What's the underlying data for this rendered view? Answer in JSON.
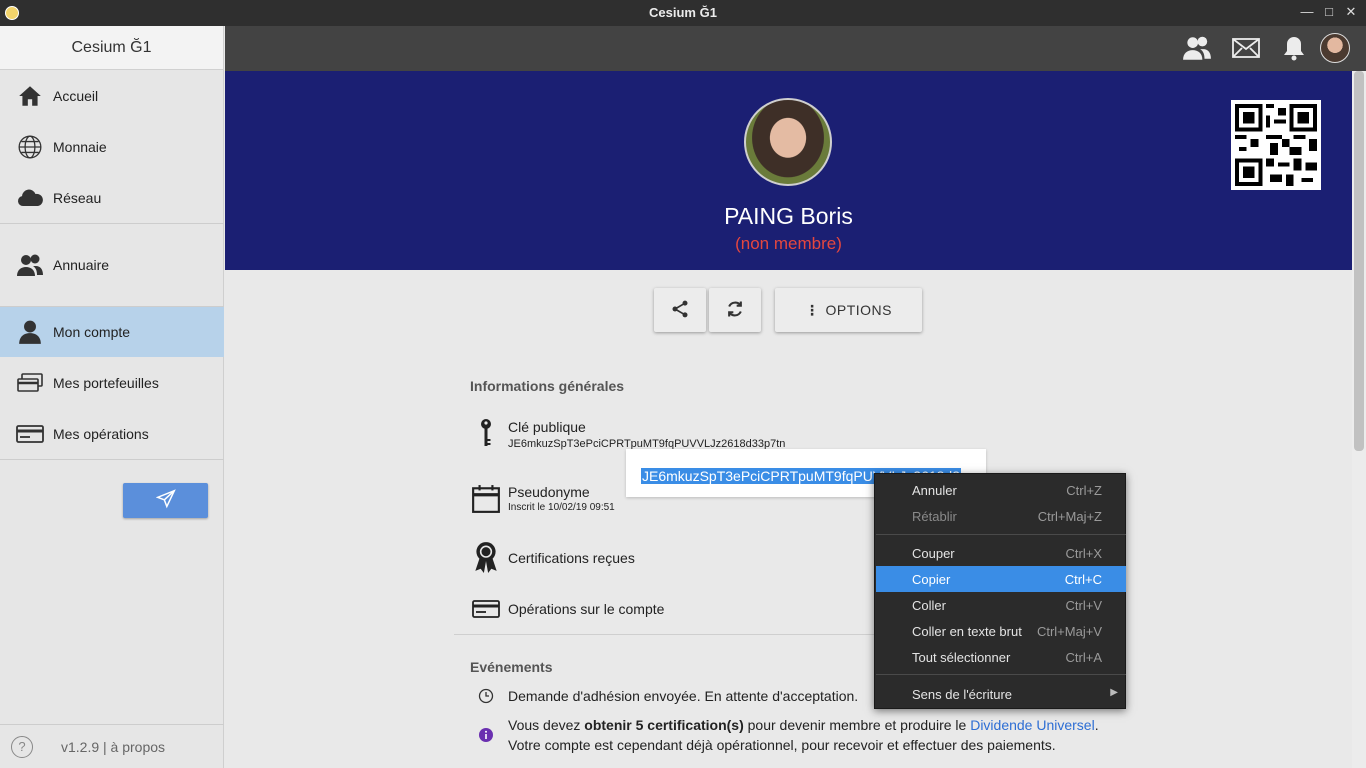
{
  "window": {
    "title": "Cesium Ğ1"
  },
  "sidebar": {
    "header": "Cesium Ğ1",
    "items": [
      {
        "label": "Accueil",
        "icon": "home-icon"
      },
      {
        "label": "Monnaie",
        "icon": "globe-icon"
      },
      {
        "label": "Réseau",
        "icon": "cloud-icon"
      },
      {
        "label": "Annuaire",
        "icon": "users-icon"
      },
      {
        "label": "Mon compte",
        "icon": "user-icon",
        "active": true
      },
      {
        "label": "Mes portefeuilles",
        "icon": "wallets-icon"
      },
      {
        "label": "Mes opérations",
        "icon": "card-icon"
      }
    ],
    "footer": {
      "help": "?",
      "version": "v1.2.9 | à propos"
    }
  },
  "profile": {
    "name": "PAING Boris",
    "status": "(non membre)"
  },
  "actions": {
    "options_label": "OPTIONS"
  },
  "general": {
    "title": "Informations générales",
    "pubkey_label": "Clé publique",
    "pubkey_value": "JE6mkuzSpT3ePciCPRTpuMT9fqPUVVLJz2618d33p7tn",
    "selected_text": "JE6mkuzSpT3ePciCPRTpuMT9fqPUVVLJz2618d33p7tn",
    "pseudo_label": "Pseudonyme",
    "pseudo_sub": "Inscrit le 10/02/19 09:51",
    "certs_label": "Certifications reçues",
    "ops_label": "Opérations sur le compte"
  },
  "events": {
    "title": "Evénements",
    "line1": "Demande d'adhésion envoyée. En attente d'acceptation.",
    "line2_pre": "Vous devez ",
    "line2_bold": "obtenir 5 certification(s)",
    "line2_mid": " pour devenir membre et produire le ",
    "line2_link": "Dividende Universel",
    "line2_end": ".",
    "line3": "Votre compte est cependant déjà opérationnel, pour recevoir et effectuer des paiements."
  },
  "context_menu": {
    "items": [
      {
        "label": "Annuler",
        "shortcut": "Ctrl+Z"
      },
      {
        "label": "Rétablir",
        "shortcut": "Ctrl+Maj+Z",
        "disabled": true
      },
      {
        "label": "Couper",
        "shortcut": "Ctrl+X"
      },
      {
        "label": "Copier",
        "shortcut": "Ctrl+C",
        "highlighted": true
      },
      {
        "label": "Coller",
        "shortcut": "Ctrl+V"
      },
      {
        "label": "Coller en texte brut",
        "shortcut": "Ctrl+Maj+V"
      },
      {
        "label": "Tout sélectionner",
        "shortcut": "Ctrl+A"
      },
      {
        "label": "Sens de l'écriture",
        "shortcut": ""
      }
    ]
  },
  "colors": {
    "hero_bg": "#1b1f73",
    "status_red": "#e5473f",
    "selection_blue": "#3a8de6",
    "active_menu": "#b7d2ea",
    "send_button": "#5b8fdb",
    "link_blue": "#2d6ed4"
  }
}
